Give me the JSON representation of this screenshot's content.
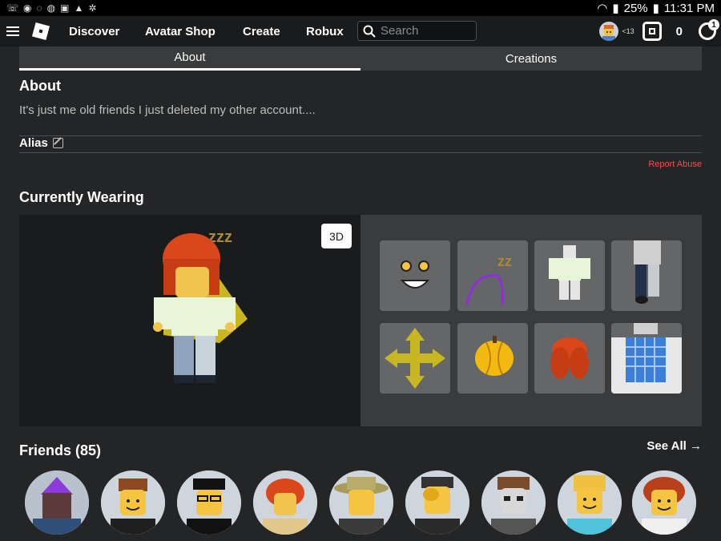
{
  "status_bar": {
    "battery": "25%",
    "time": "11:31 PM",
    "left_icons": [
      "phone-missed-icon",
      "record-icon",
      "circle-icon",
      "messenger-icon",
      "message-icon",
      "warning-icon",
      "bug-icon"
    ]
  },
  "nav": {
    "links": [
      "Discover",
      "Avatar Shop",
      "Create",
      "Robux"
    ],
    "search_placeholder": "Search",
    "age_label": "<13",
    "robux_count": "0",
    "settings_badge": "1"
  },
  "tabs": [
    {
      "label": "About",
      "active": true
    },
    {
      "label": "Creations",
      "active": false
    }
  ],
  "about": {
    "heading": "About",
    "text": "It's just me old friends I just deleted my other account....",
    "alias_label": "Alias",
    "report_label": "Report Abuse"
  },
  "wearing": {
    "heading": "Currently Wearing",
    "button_3d": "3D",
    "items": [
      "face-item",
      "zzz-headband-item",
      "green-shirt-item",
      "dark-pants-item",
      "yellow-arrows-item",
      "pumpkin-item",
      "red-hair-item",
      "blue-plaid-item"
    ]
  },
  "friends": {
    "heading": "Friends (85)",
    "see_all": "See All →",
    "count": 9
  },
  "colors": {
    "background": "#232527",
    "nav": "#191b1d",
    "panel": "#393b3d",
    "item_tile": "#656668",
    "report": "#f74b52"
  }
}
